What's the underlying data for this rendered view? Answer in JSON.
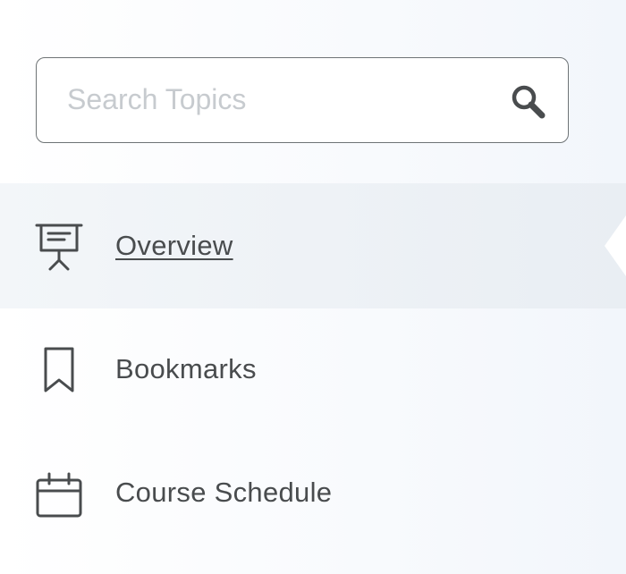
{
  "search": {
    "placeholder": "Search Topics",
    "value": "",
    "icon": "search-icon"
  },
  "nav": {
    "items": [
      {
        "label": "Overview",
        "icon": "presentation-icon",
        "active": true
      },
      {
        "label": "Bookmarks",
        "icon": "bookmark-icon",
        "active": false
      },
      {
        "label": "Course Schedule",
        "icon": "calendar-icon",
        "active": false
      }
    ]
  },
  "colors": {
    "text": "#494c4e",
    "placeholder": "#c7cbcf",
    "border": "#6e7376",
    "active_bg": "#e9eef3"
  }
}
